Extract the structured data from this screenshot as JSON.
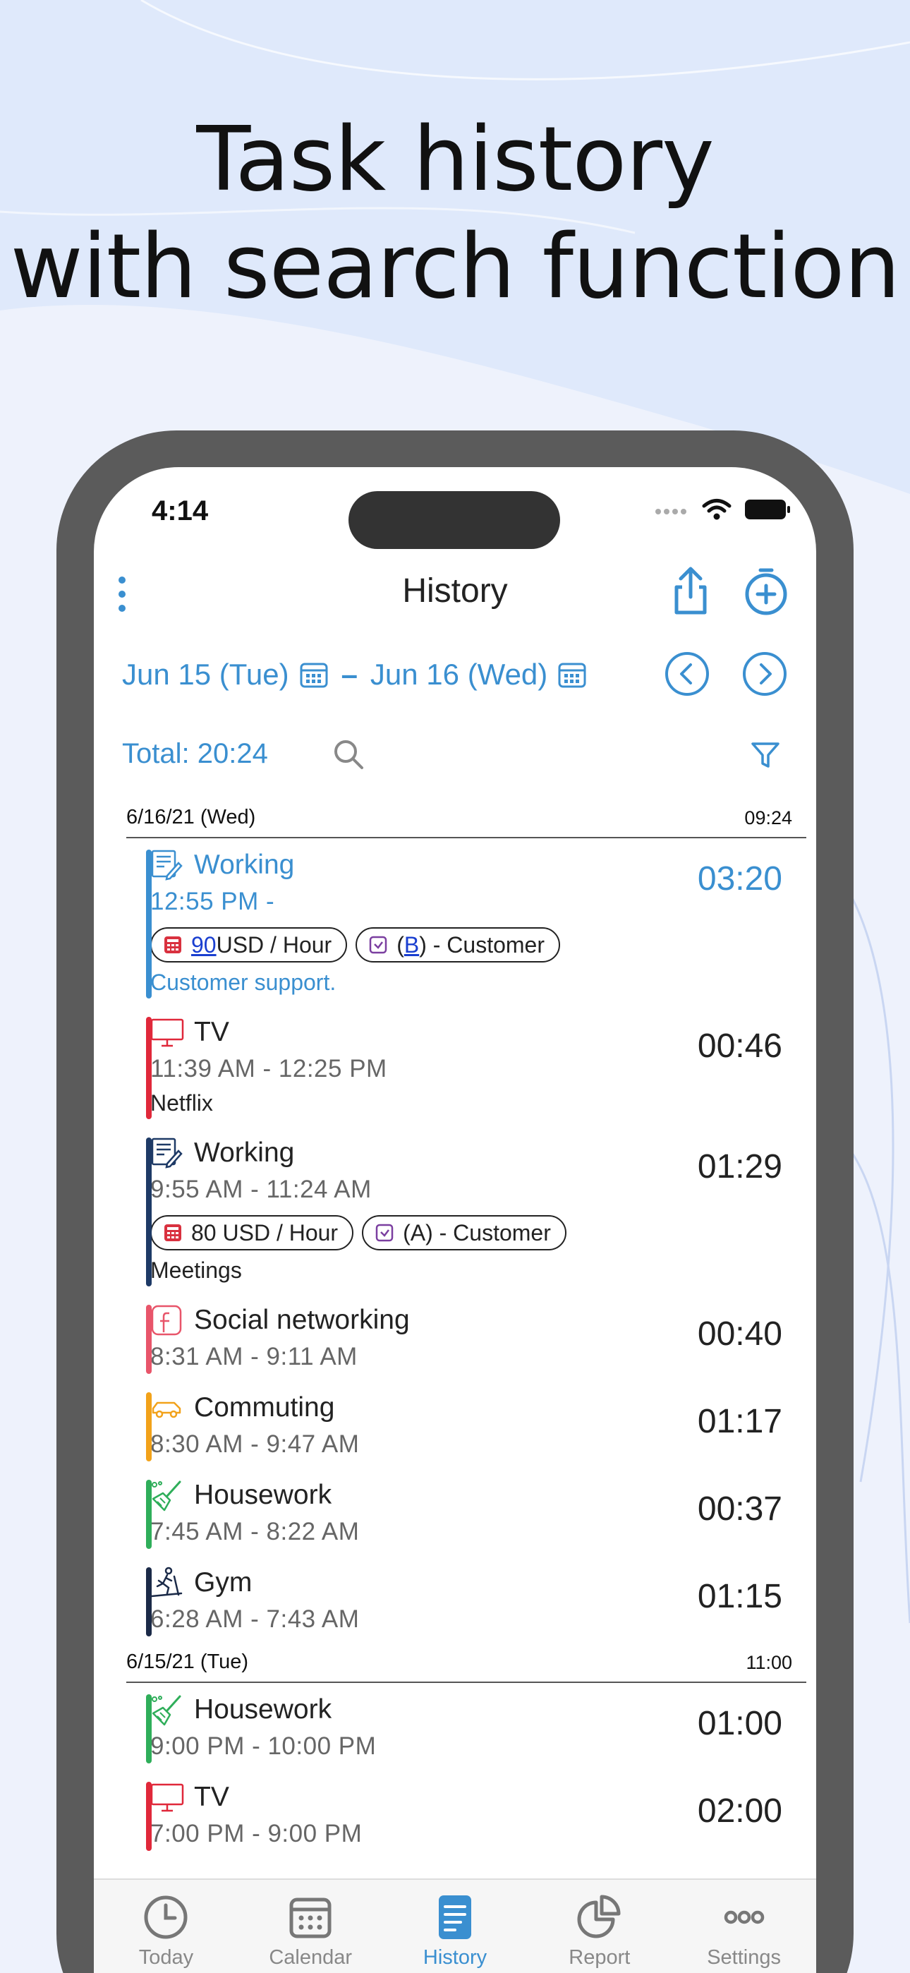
{
  "headline": {
    "line1": "Task history",
    "line2": "with search function"
  },
  "status_bar": {
    "time": "4:14"
  },
  "nav": {
    "title": "History"
  },
  "date_range": {
    "start": "Jun  15  (Tue)",
    "dash": "–",
    "end": "Jun  16  (Wed)"
  },
  "summary": {
    "total": "Total: 20:24"
  },
  "colors": {
    "accent": "#3a8fd0",
    "red": "#e0283a",
    "navy": "#1e3a66",
    "pink": "#e8556a",
    "orange": "#f2a21a",
    "green": "#2fae5a",
    "dark_navy": "#1b2a48"
  },
  "days": [
    {
      "date": "6/16/21 (Wed)",
      "total": "09:24",
      "entries": [
        {
          "icon": "notepad-pencil-icon",
          "name": "Working",
          "time": "12:55 PM -",
          "duration": "03:20",
          "color": "#3a8fd0",
          "active": true,
          "chips": [
            {
              "icon": "calculator-icon",
              "prefix": "90",
              "text": " USD / Hour"
            },
            {
              "icon": "checkbox-icon",
              "prefix": "(",
              "link": "B",
              "text": ") - Customer"
            }
          ],
          "note": "Customer support."
        },
        {
          "icon": "tv-icon",
          "name": "TV",
          "time": "11:39 AM - 12:25 PM",
          "duration": "00:46",
          "color": "#e0283a",
          "note": "Netflix"
        },
        {
          "icon": "notepad-pencil-icon",
          "name": "Working",
          "time": "9:55 AM - 11:24 AM",
          "duration": "01:29",
          "color": "#1e3a66",
          "chips": [
            {
              "icon": "calculator-icon",
              "text": "80 USD / Hour"
            },
            {
              "icon": "checkbox-icon",
              "text": "(A) - Customer"
            }
          ],
          "note": "Meetings"
        },
        {
          "icon": "facebook-icon",
          "name": "Social networking",
          "time": "8:31 AM - 9:11 AM",
          "duration": "00:40",
          "color": "#e8556a"
        },
        {
          "icon": "car-icon",
          "name": "Commuting",
          "time": "8:30 AM - 9:47 AM",
          "duration": "01:17",
          "color": "#f2a21a"
        },
        {
          "icon": "broom-icon",
          "name": "Housework",
          "time": "7:45 AM - 8:22 AM",
          "duration": "00:37",
          "color": "#2fae5a"
        },
        {
          "icon": "treadmill-icon",
          "name": "Gym",
          "time": "6:28 AM - 7:43 AM",
          "duration": "01:15",
          "color": "#1b2a48"
        }
      ]
    },
    {
      "date": "6/15/21 (Tue)",
      "total": "11:00",
      "entries": [
        {
          "icon": "broom-icon",
          "name": "Housework",
          "time": "9:00 PM - 10:00 PM",
          "duration": "01:00",
          "color": "#2fae5a"
        },
        {
          "icon": "tv-icon",
          "name": "TV",
          "time": "7:00 PM - 9:00 PM",
          "duration": "02:00",
          "color": "#e0283a"
        }
      ]
    }
  ],
  "tabs": [
    {
      "label": "Today",
      "icon": "clock-icon"
    },
    {
      "label": "Calendar",
      "icon": "calendar-icon"
    },
    {
      "label": "History",
      "icon": "history-icon",
      "active": true
    },
    {
      "label": "Report",
      "icon": "pie-chart-icon"
    },
    {
      "label": "Settings",
      "icon": "more-icon"
    }
  ]
}
